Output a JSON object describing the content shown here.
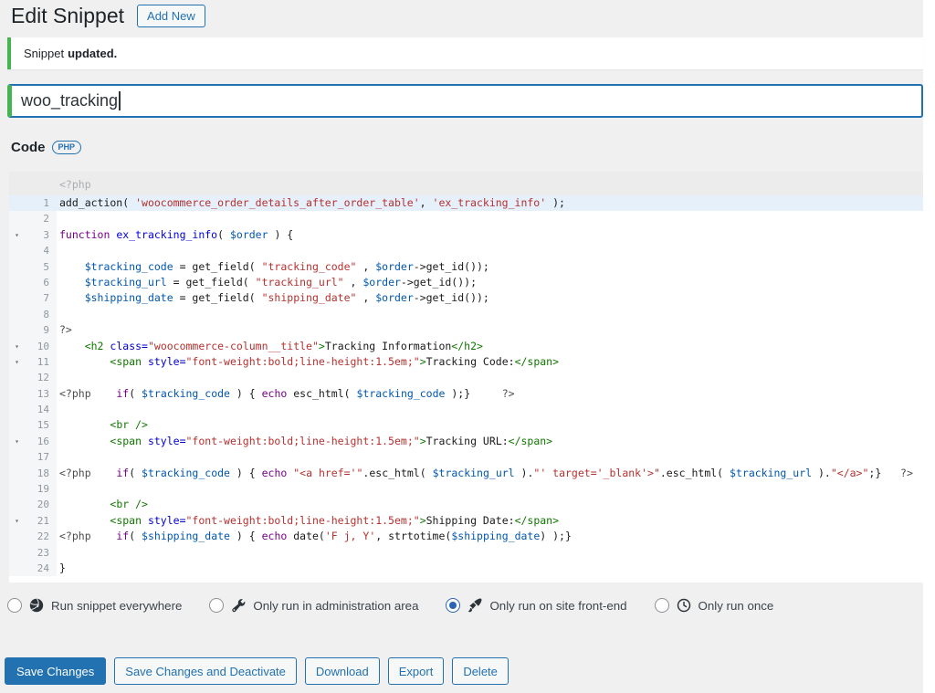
{
  "colors": {
    "accent": "#2271b1",
    "notice_green": "#46b450",
    "active_line": "#e5f0fb",
    "page_background": "#f0f0f1"
  },
  "header": {
    "title": "Edit Snippet",
    "add_new_label": "Add New"
  },
  "notice": {
    "text_prefix": "Snippet",
    "text_bold": "updated."
  },
  "title_field": {
    "value": "woo_tracking"
  },
  "code_section": {
    "label": "Code",
    "badge": "PHP"
  },
  "editor": {
    "pre_line_text": "<?php",
    "lines": [
      {
        "n": 1,
        "active": true,
        "tokens": [
          [
            "p",
            "add_action( "
          ],
          [
            "s",
            "'woocommerce_order_details_after_order_table'"
          ],
          [
            "p",
            ", "
          ],
          [
            "s",
            "'ex_tracking_info'"
          ],
          [
            "p",
            " );"
          ]
        ]
      },
      {
        "n": 2,
        "tokens": []
      },
      {
        "n": 3,
        "fold": true,
        "tokens": [
          [
            "k",
            "function"
          ],
          [
            "p",
            " "
          ],
          [
            "d",
            "ex_tracking_info"
          ],
          [
            "p",
            "( "
          ],
          [
            "v",
            "$order"
          ],
          [
            "p",
            " ) {"
          ]
        ]
      },
      {
        "n": 4,
        "tokens": []
      },
      {
        "n": 5,
        "tokens": [
          [
            "p",
            "    "
          ],
          [
            "v",
            "$tracking_code"
          ],
          [
            "p",
            " = get_field( "
          ],
          [
            "s",
            "\"tracking_code\""
          ],
          [
            "p",
            " , "
          ],
          [
            "v",
            "$order"
          ],
          [
            "p",
            "->get_id());"
          ]
        ]
      },
      {
        "n": 6,
        "tokens": [
          [
            "p",
            "    "
          ],
          [
            "v",
            "$tracking_url"
          ],
          [
            "p",
            " = get_field( "
          ],
          [
            "s",
            "\"tracking_url\""
          ],
          [
            "p",
            " , "
          ],
          [
            "v",
            "$order"
          ],
          [
            "p",
            "->get_id());"
          ]
        ]
      },
      {
        "n": 7,
        "tokens": [
          [
            "p",
            "    "
          ],
          [
            "v",
            "$shipping_date"
          ],
          [
            "p",
            " = get_field( "
          ],
          [
            "s",
            "\"shipping_date\""
          ],
          [
            "p",
            " , "
          ],
          [
            "v",
            "$order"
          ],
          [
            "p",
            "->get_id());"
          ]
        ]
      },
      {
        "n": 8,
        "tokens": []
      },
      {
        "n": 9,
        "tokens": [
          [
            "m",
            "?>"
          ]
        ]
      },
      {
        "n": 10,
        "fold": true,
        "tokens": [
          [
            "p",
            "    "
          ],
          [
            "t",
            "<h2"
          ],
          [
            "p",
            " "
          ],
          [
            "a",
            "class="
          ],
          [
            "s",
            "\"woocommerce-column__title\""
          ],
          [
            "t",
            ">"
          ],
          [
            "p",
            "Tracking Information"
          ],
          [
            "t",
            "</h2>"
          ]
        ]
      },
      {
        "n": 11,
        "fold": true,
        "tokens": [
          [
            "p",
            "        "
          ],
          [
            "t",
            "<span"
          ],
          [
            "p",
            " "
          ],
          [
            "a",
            "style="
          ],
          [
            "s",
            "\"font-weight:bold;line-height:1.5em;\""
          ],
          [
            "t",
            ">"
          ],
          [
            "p",
            "Tracking Code:"
          ],
          [
            "t",
            "</span>"
          ]
        ]
      },
      {
        "n": 12,
        "tokens": []
      },
      {
        "n": 13,
        "tokens": [
          [
            "m",
            "<?php"
          ],
          [
            "p",
            "    "
          ],
          [
            "k",
            "if"
          ],
          [
            "p",
            "( "
          ],
          [
            "v",
            "$tracking_code"
          ],
          [
            "p",
            " ) { "
          ],
          [
            "k",
            "echo"
          ],
          [
            "p",
            " esc_html( "
          ],
          [
            "v",
            "$tracking_code"
          ],
          [
            "p",
            " );}     "
          ],
          [
            "m",
            "?>"
          ]
        ]
      },
      {
        "n": 14,
        "tokens": []
      },
      {
        "n": 15,
        "tokens": [
          [
            "p",
            "        "
          ],
          [
            "t",
            "<br />"
          ]
        ]
      },
      {
        "n": 16,
        "fold": true,
        "tokens": [
          [
            "p",
            "        "
          ],
          [
            "t",
            "<span"
          ],
          [
            "p",
            " "
          ],
          [
            "a",
            "style="
          ],
          [
            "s",
            "\"font-weight:bold;line-height:1.5em;\""
          ],
          [
            "t",
            ">"
          ],
          [
            "p",
            "Tracking URL:"
          ],
          [
            "t",
            "</span>"
          ]
        ]
      },
      {
        "n": 17,
        "tokens": []
      },
      {
        "n": 18,
        "tokens": [
          [
            "m",
            "<?php"
          ],
          [
            "p",
            "    "
          ],
          [
            "k",
            "if"
          ],
          [
            "p",
            "( "
          ],
          [
            "v",
            "$tracking_code"
          ],
          [
            "p",
            " ) { "
          ],
          [
            "k",
            "echo"
          ],
          [
            "p",
            " "
          ],
          [
            "s",
            "\"<a href='\""
          ],
          [
            "p",
            ".esc_html( "
          ],
          [
            "v",
            "$tracking_url"
          ],
          [
            "p",
            " )."
          ],
          [
            "s",
            "\"' target='_blank'>\""
          ],
          [
            "p",
            ".esc_html( "
          ],
          [
            "v",
            "$tracking_url"
          ],
          [
            "p",
            " )."
          ],
          [
            "s",
            "\"</a>\""
          ],
          [
            "p",
            ";}   "
          ],
          [
            "m",
            "?>"
          ]
        ]
      },
      {
        "n": 19,
        "tokens": []
      },
      {
        "n": 20,
        "tokens": [
          [
            "p",
            "        "
          ],
          [
            "t",
            "<br />"
          ]
        ]
      },
      {
        "n": 21,
        "fold": true,
        "tokens": [
          [
            "p",
            "        "
          ],
          [
            "t",
            "<span"
          ],
          [
            "p",
            " "
          ],
          [
            "a",
            "style="
          ],
          [
            "s",
            "\"font-weight:bold;line-height:1.5em;\""
          ],
          [
            "t",
            ">"
          ],
          [
            "p",
            "Shipping Date:"
          ],
          [
            "t",
            "</span>"
          ]
        ]
      },
      {
        "n": 22,
        "tokens": [
          [
            "m",
            "<?php"
          ],
          [
            "p",
            "    "
          ],
          [
            "k",
            "if"
          ],
          [
            "p",
            "( "
          ],
          [
            "v",
            "$shipping_date"
          ],
          [
            "p",
            " ) { "
          ],
          [
            "k",
            "echo"
          ],
          [
            "p",
            " date("
          ],
          [
            "s",
            "'F j, Y'"
          ],
          [
            "p",
            ", strtotime("
          ],
          [
            "v",
            "$shipping_date"
          ],
          [
            "p",
            ") );}"
          ]
        ]
      },
      {
        "n": 23,
        "tokens": []
      },
      {
        "n": 24,
        "tokens": [
          [
            "p",
            "}"
          ]
        ]
      }
    ]
  },
  "scope": {
    "options": [
      {
        "label": "Run snippet everywhere",
        "icon": "globe-icon",
        "selected": false
      },
      {
        "label": "Only run in administration area",
        "icon": "wrench-icon",
        "selected": false
      },
      {
        "label": "Only run on site front-end",
        "icon": "paintbrush-icon",
        "selected": true
      },
      {
        "label": "Only run once",
        "icon": "clock-icon",
        "selected": false
      }
    ]
  },
  "actions": {
    "buttons": [
      {
        "label": "Save Changes",
        "primary": true
      },
      {
        "label": "Save Changes and Deactivate",
        "primary": false
      },
      {
        "label": "Download",
        "primary": false
      },
      {
        "label": "Export",
        "primary": false
      },
      {
        "label": "Delete",
        "primary": false
      }
    ]
  }
}
